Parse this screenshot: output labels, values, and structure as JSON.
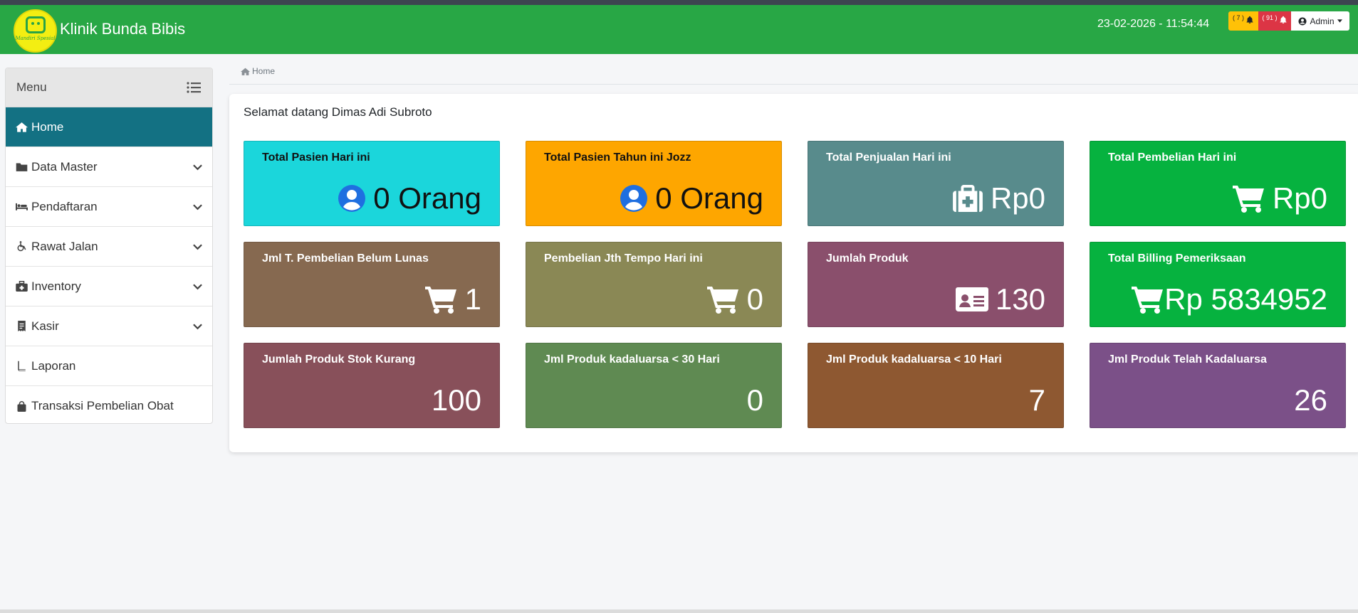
{
  "app": {
    "title": "Klinik Bunda Bibis",
    "logo_tagline": "Mandiri Spesial"
  },
  "header": {
    "datetime": "23-02-2026 -  11:54:44",
    "notif_warning_count": "( 7 )",
    "notif_danger_count": "( 91 )",
    "user_label": "Admin",
    "icons": [
      "bell-icon",
      "user-circle-icon",
      "caret-down-icon"
    ]
  },
  "sidebar": {
    "header": "Menu",
    "items": [
      {
        "label": "Home",
        "icon": "home-icon",
        "active": true
      },
      {
        "label": "Data Master",
        "icon": "folder-icon",
        "chevron": true
      },
      {
        "label": "Pendaftaran",
        "icon": "bed-icon",
        "chevron": true
      },
      {
        "label": "Rawat Jalan",
        "icon": "wheelchair-icon",
        "chevron": true
      },
      {
        "label": "Inventory",
        "icon": "medkit-icon",
        "chevron": true
      },
      {
        "label": "Kasir",
        "icon": "receipt-icon",
        "chevron": true
      },
      {
        "label": "Laporan",
        "icon": "book-icon"
      },
      {
        "label": "Transaksi Pembelian Obat",
        "icon": "shopping-bag-icon"
      }
    ]
  },
  "breadcrumb": {
    "home": "Home"
  },
  "main": {
    "welcome": "Selamat datang Dimas Adi Subroto",
    "cards": [
      {
        "title": "Total Pasien Hari ini",
        "value": "0 Orang",
        "icon": "user-circle-icon",
        "color": "#1bd6db"
      },
      {
        "title": "Total Pasien Tahun ini Jozz",
        "value": "0 Orang",
        "icon": "user-circle-icon",
        "color": "#fea600"
      },
      {
        "title": "Total Penjualan Hari ini",
        "value": "Rp0",
        "icon": "medkit-icon",
        "color": "#588b8c"
      },
      {
        "title": "Total Pembelian Hari ini",
        "value": "Rp0",
        "icon": "cart-icon",
        "color": "#06b23f"
      },
      {
        "title": "Jml T. Pembelian Belum Lunas",
        "value": "1",
        "icon": "cart-icon",
        "color": "#866950"
      },
      {
        "title": "Pembelian Jth Tempo Hari ini",
        "value": "0",
        "icon": "cart-icon",
        "color": "#8a8855"
      },
      {
        "title": "Jumlah Produk",
        "value": "130",
        "icon": "id-card-icon",
        "color": "#8a4f6c"
      },
      {
        "title": "Total Billing Pemeriksaan",
        "value": "Rp 5834952",
        "icon": "cart-icon",
        "color": "#06b23f"
      },
      {
        "title": "Jumlah Produk Stok Kurang",
        "value": "100",
        "color": "#88505a"
      },
      {
        "title": "Jml Produk kadaluarsa < 30 Hari",
        "value": "0",
        "color": "#5f8a52"
      },
      {
        "title": "Jml Produk kadaluarsa < 10 Hari",
        "value": "7",
        "color": "#8e5831"
      },
      {
        "title": "Jml Produk Telah Kadaluarsa",
        "value": "26",
        "color": "#7b5088"
      }
    ]
  }
}
